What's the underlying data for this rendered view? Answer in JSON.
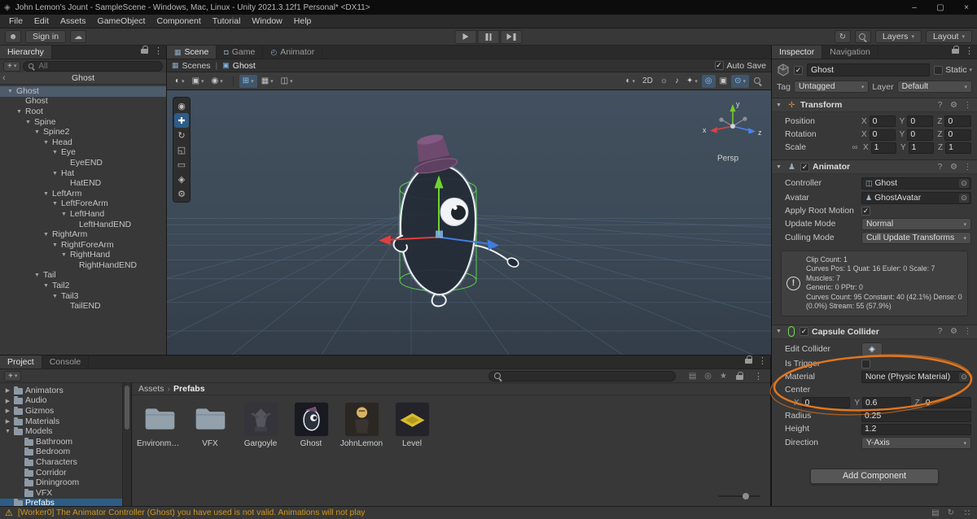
{
  "colors": {
    "annotation": "#e1771f",
    "warning": "#d09a1c",
    "selection": "#2d5d87",
    "selection_unfocused": "#4d5b6b",
    "accent": "#7fb8ea"
  },
  "icons": {
    "caret": "▾",
    "foldout_open": "▼",
    "foldout_closed": "▶",
    "kebab": "⋮",
    "breadcrumb_sep": "›",
    "pipe": "|",
    "back": "‹",
    "warning": "⚠",
    "info": "!",
    "picker": "⊙",
    "link": "∞",
    "help": "?",
    "presets": "⚙",
    "cloud": "☁",
    "account": "☻",
    "history": "↻",
    "logo": "◈",
    "edit_collider": "◈"
  },
  "window": {
    "title": "John Lemon's Jount - SampleScene - Windows, Mac, Linux - Unity 2021.3.12f1 Personal* <DX11>",
    "minimize": "–",
    "maximize": "▢",
    "close": "×"
  },
  "menu_bar": [
    "File",
    "Edit",
    "Assets",
    "GameObject",
    "Component",
    "Tutorial",
    "Window",
    "Help"
  ],
  "toolbar": {
    "sign_in": "Sign in",
    "layers": "Layers",
    "layout": "Layout"
  },
  "hierarchy": {
    "tab": "Hierarchy",
    "create_button": "+",
    "search_placeholder": "All",
    "scene_header": "Ghost",
    "tree": [
      {
        "label": "Ghost",
        "depth": 0,
        "arrow": true,
        "selected": true
      },
      {
        "label": "Ghost",
        "depth": 1,
        "arrow": false
      },
      {
        "label": "Root",
        "depth": 1,
        "arrow": true
      },
      {
        "label": "Spine",
        "depth": 2,
        "arrow": true
      },
      {
        "label": "Spine2",
        "depth": 3,
        "arrow": true
      },
      {
        "label": "Head",
        "depth": 4,
        "arrow": true
      },
      {
        "label": "Eye",
        "depth": 5,
        "arrow": true
      },
      {
        "label": "EyeEND",
        "depth": 6,
        "arrow": false
      },
      {
        "label": "Hat",
        "depth": 5,
        "arrow": true
      },
      {
        "label": "HatEND",
        "depth": 6,
        "arrow": false
      },
      {
        "label": "LeftArm",
        "depth": 4,
        "arrow": true
      },
      {
        "label": "LeftForeArm",
        "depth": 5,
        "arrow": true
      },
      {
        "label": "LeftHand",
        "depth": 6,
        "arrow": true
      },
      {
        "label": "LeftHandEND",
        "depth": 7,
        "arrow": false
      },
      {
        "label": "RightArm",
        "depth": 4,
        "arrow": true
      },
      {
        "label": "RightForeArm",
        "depth": 5,
        "arrow": true
      },
      {
        "label": "RightHand",
        "depth": 6,
        "arrow": true
      },
      {
        "label": "RightHandEND",
        "depth": 7,
        "arrow": false
      },
      {
        "label": "Tail",
        "depth": 3,
        "arrow": true
      },
      {
        "label": "Tail2",
        "depth": 4,
        "arrow": true
      },
      {
        "label": "Tail3",
        "depth": 5,
        "arrow": true
      },
      {
        "label": "TailEND",
        "depth": 6,
        "arrow": false
      }
    ]
  },
  "scene_view": {
    "tabs": [
      {
        "label": "Scene",
        "active": true
      },
      {
        "label": "Game"
      },
      {
        "label": "Animator"
      }
    ],
    "breadcrumb": {
      "root": "Scenes",
      "current": "Ghost"
    },
    "auto_save_label": "Auto Save",
    "axis": {
      "x": "x",
      "y": "y",
      "z": "z",
      "persp": "Persp"
    },
    "toolbar": {
      "left": [
        {
          "name": "tool-settings-dropdown",
          "glyph": "◐",
          "dropdown": true
        },
        {
          "name": "pivot-point-dropdown",
          "glyph": "▣",
          "dropdown": true
        },
        {
          "name": "pivot-rotation-dropdown",
          "glyph": "◉",
          "dropdown": true
        }
      ],
      "snap": [
        {
          "name": "grid-snap-toggle",
          "glyph": "⊞",
          "dropdown": true,
          "active": true
        },
        {
          "name": "grid-visibility-dropdown",
          "glyph": "▦",
          "dropdown": true
        },
        {
          "name": "snap-increment-dropdown",
          "glyph": "◫",
          "dropdown": true
        }
      ],
      "right": [
        {
          "name": "shading-mode-dropdown",
          "glyph": "◐",
          "dropdown": true
        },
        {
          "name": "mode-2d-toggle",
          "glyph": "2D"
        },
        {
          "name": "scene-lighting-toggle",
          "glyph": "☼"
        },
        {
          "name": "scene-audio-toggle",
          "glyph": "♪"
        },
        {
          "name": "effects-dropdown",
          "glyph": "✦",
          "dropdown": true
        },
        {
          "name": "scene-visibility-toggle",
          "glyph": "◎",
          "active": true
        },
        {
          "name": "camera-settings-button",
          "glyph": "▣"
        },
        {
          "name": "gizmos-dropdown",
          "glyph": "⊙",
          "dropdown": true,
          "active": true
        },
        {
          "name": "scene-search-button",
          "glyph": "mag"
        }
      ]
    },
    "tools": [
      {
        "name": "view-tool",
        "glyph": "◉"
      },
      {
        "name": "move-tool",
        "glyph": "✚",
        "active": true
      },
      {
        "name": "rotate-tool",
        "glyph": "↻"
      },
      {
        "name": "scale-tool",
        "glyph": "◱"
      },
      {
        "name": "rect-tool",
        "glyph": "▭"
      },
      {
        "name": "transform-tool",
        "glyph": "◈"
      },
      {
        "name": "custom-tool",
        "glyph": "⚙"
      }
    ]
  },
  "project": {
    "tabs": [
      {
        "label": "Project",
        "active": true
      },
      {
        "label": "Console"
      }
    ],
    "create_button": "+",
    "search_placeholder": "",
    "folders": [
      {
        "label": "Animators",
        "depth": 0,
        "arrow": "right"
      },
      {
        "label": "Audio",
        "depth": 0,
        "arrow": "right"
      },
      {
        "label": "Gizmos",
        "depth": 0,
        "arrow": "right"
      },
      {
        "label": "Materials",
        "depth": 0,
        "arrow": "right"
      },
      {
        "label": "Models",
        "depth": 0,
        "arrow": "down"
      },
      {
        "label": "Bathroom",
        "depth": 1
      },
      {
        "label": "Bedroom",
        "depth": 1
      },
      {
        "label": "Characters",
        "depth": 1
      },
      {
        "label": "Corridor",
        "depth": 1
      },
      {
        "label": "Diningroom",
        "depth": 1
      },
      {
        "label": "VFX",
        "depth": 1
      },
      {
        "label": "Prefabs",
        "depth": 0,
        "selected": true
      }
    ],
    "breadcrumb": [
      "Assets",
      "Prefabs"
    ],
    "assets": [
      {
        "label": "Environme...",
        "type": "folder"
      },
      {
        "label": "VFX",
        "type": "folder"
      },
      {
        "label": "Gargoyle",
        "type": "gargoyle"
      },
      {
        "label": "Ghost",
        "type": "ghost"
      },
      {
        "label": "JohnLemon",
        "type": "johnlemon"
      },
      {
        "label": "Level",
        "type": "level"
      }
    ]
  },
  "inspector": {
    "tabs": [
      {
        "label": "Inspector",
        "active": true
      },
      {
        "label": "Navigation"
      }
    ],
    "header": {
      "name": "Ghost",
      "static_label": "Static",
      "tag_label": "Tag",
      "tag_value": "Untagged",
      "layer_label": "Layer",
      "layer_value": "Default"
    },
    "transform": {
      "title": "Transform",
      "axis": [
        "X",
        "Y",
        "Z"
      ],
      "rows": [
        {
          "label": "Position",
          "values": [
            "0",
            "0",
            "0"
          ]
        },
        {
          "label": "Rotation",
          "values": [
            "0",
            "0",
            "0"
          ]
        },
        {
          "label": "Scale",
          "values": [
            "1",
            "1",
            "1"
          ],
          "link": true
        }
      ]
    },
    "animator": {
      "title": "Animator",
      "controller_label": "Controller",
      "controller_value": "Ghost",
      "avatar_label": "Avatar",
      "avatar_value": "GhostAvatar",
      "apply_root_motion_label": "Apply Root Motion",
      "update_mode_label": "Update Mode",
      "update_mode_value": "Normal",
      "culling_mode_label": "Culling Mode",
      "culling_mode_value": "Cull Update Transforms",
      "info_lines": [
        "Clip Count: 1",
        "Curves Pos: 1 Quat: 16 Euler: 0 Scale: 7 Muscles: 7",
        "Generic: 0 PPtr: 0",
        "Curves Count: 95 Constant: 40 (42.1%) Dense: 0",
        "(0.0%) Stream: 55 (57.9%)"
      ]
    },
    "capsule": {
      "title": "Capsule Collider",
      "edit_collider_label": "Edit Collider",
      "is_trigger_label": "Is Trigger",
      "material_label": "Material",
      "material_value": "None (Physic Material)",
      "center_label": "Center",
      "center": {
        "x": "0",
        "y": "0.6",
        "z": "0"
      },
      "radius_label": "Radius",
      "radius_value": "0.25",
      "height_label": "Height",
      "height_value": "1.2",
      "direction_label": "Direction",
      "direction_value": "Y-Axis"
    },
    "add_component": "Add Component"
  },
  "status_bar": {
    "message": "[Worker0] The Animator Controller (Ghost) you have used is not valid. Animations will not play"
  }
}
